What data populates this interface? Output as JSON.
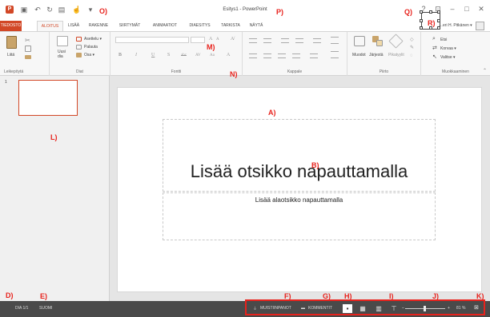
{
  "titlebar": {
    "title": "Esitys1 - PowerPoint",
    "help": "?",
    "minimize": "–",
    "maximize": "□",
    "close": "✕"
  },
  "tabs": [
    "TIEDOSTO",
    "ALOITUS",
    "LISÄÄ",
    "RAKENNE",
    "SIIRTYMÄT",
    "ANIMAATIOT",
    "DIAESITYS",
    "TARKISTA",
    "NÄYTÄ"
  ],
  "user": {
    "name": "…eri H. Pitkänen ▾"
  },
  "ribbon": {
    "clipboard": {
      "paste": "Liitä",
      "label": "Leikepöytä"
    },
    "slides": {
      "new_slide": "Uusi\ndia",
      "layout": "Asettelu ▾",
      "reset": "Palauta",
      "section": "Osa ▾",
      "label": "Diat"
    },
    "font": {
      "bold": "B",
      "italic": "I",
      "underline": "U",
      "shadow": "S",
      "strike": "abc",
      "spacing": "AV",
      "case": "Aa",
      "color": "A",
      "grow": "A",
      "shrink": "A",
      "label": "Fontti"
    },
    "paragraph": {
      "label": "Kappale"
    },
    "drawing": {
      "shapes": "Muodot",
      "arrange": "Järjestä",
      "quick_styles": "Pikatyylit",
      "label": "Piirto"
    },
    "editing": {
      "find": "Etsi",
      "replace": "Korvaa ▾",
      "select": "Valitse ▾",
      "label": "Muokkaaminen"
    }
  },
  "thumbnails": {
    "slide_number": "1"
  },
  "slide": {
    "title_placeholder": "Lisää otsikko napauttamalla",
    "subtitle_placeholder": "Lisää alaotsikko napauttamalla"
  },
  "statusbar": {
    "slide_count": "DIA 1/1",
    "language": "SUOMI",
    "notes": "MUISTIINPANOT",
    "comments": "KOMMENTIT",
    "zoom": "81 %",
    "zoom_level_percent": 81
  },
  "annotations": {
    "A": "A)",
    "B": "B)",
    "D": "D)",
    "E": "E)",
    "F": "F)",
    "G": "G)",
    "H": "H)",
    "I": "I)",
    "J": "J)",
    "K": "K)",
    "L": "L)",
    "M": "M)",
    "N": "N)",
    "O": "O)",
    "P": "P)",
    "Q": "Q)",
    "R": "R)"
  },
  "colors": {
    "accent": "#d24726",
    "annotation": "#e8221c",
    "statusbar": "#4a4a4a"
  }
}
